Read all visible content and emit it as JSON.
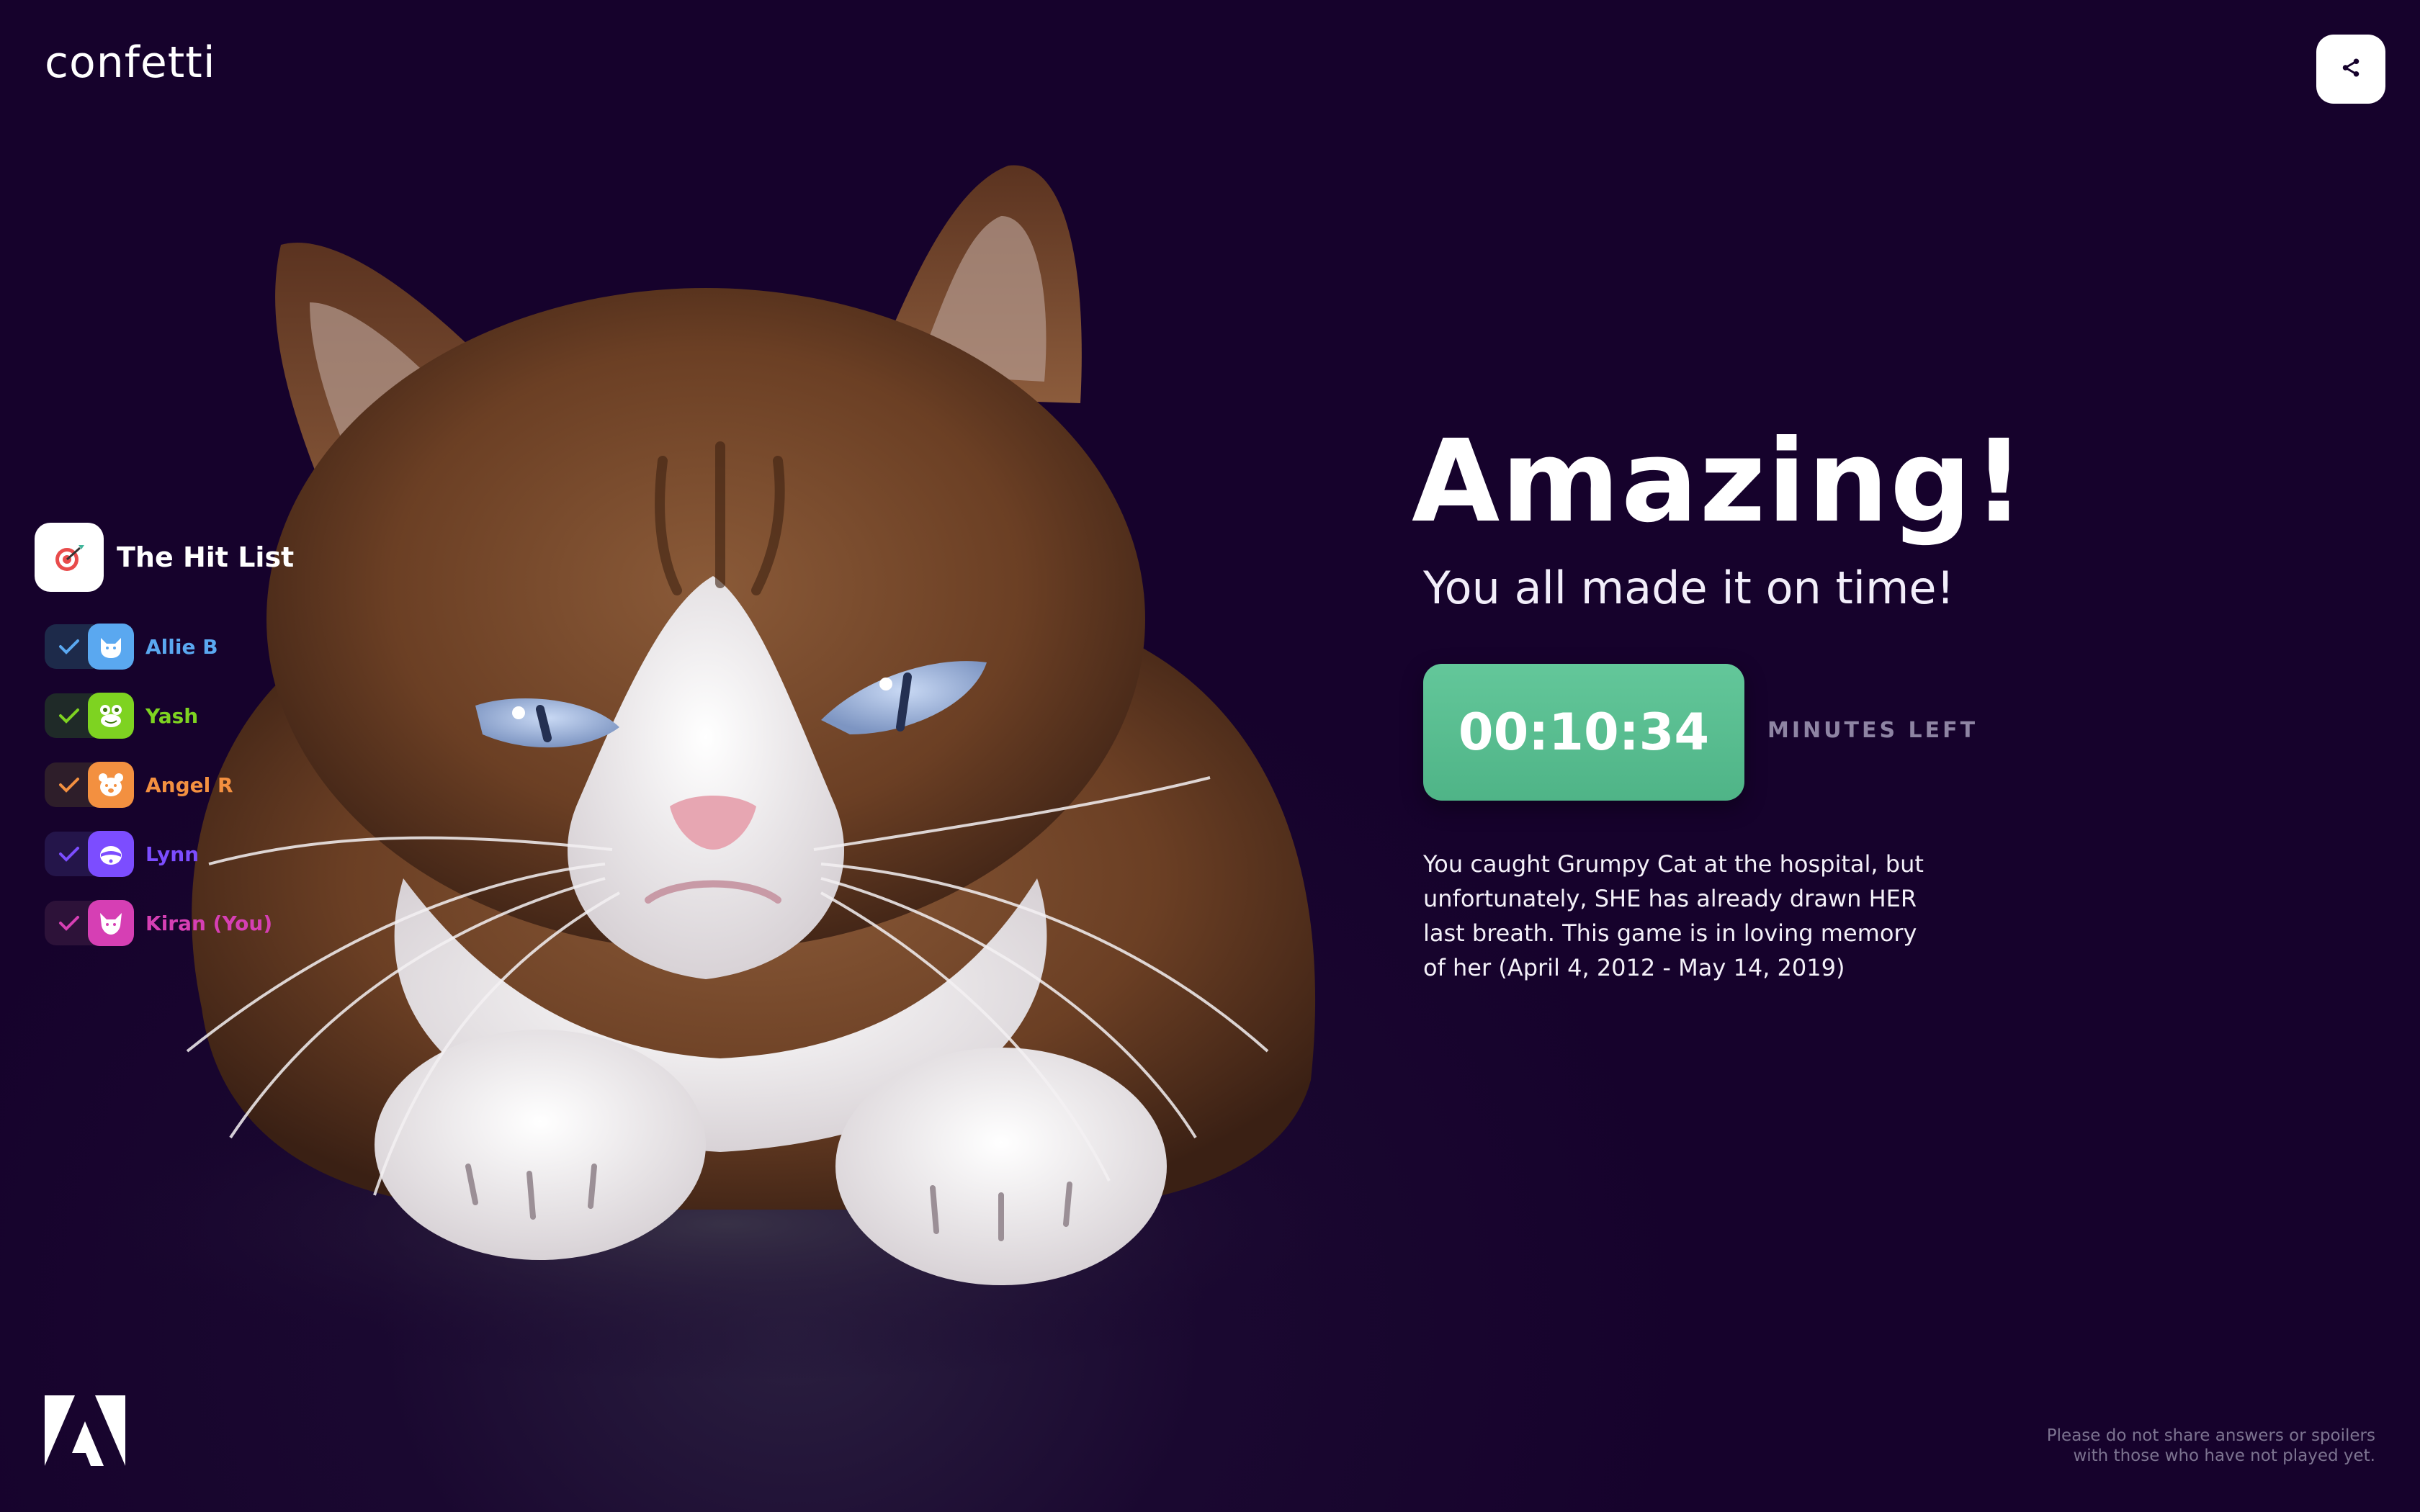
{
  "brand": {
    "logo_text": "confetti"
  },
  "header": {
    "share_icon": "share-icon"
  },
  "hitlist": {
    "title": "The Hit List",
    "icon": "target-icon",
    "players": [
      {
        "name": "Allie B",
        "avatar": "cat-avatar-icon",
        "color": "#5aa8f0",
        "bg": "#1d2a4a"
      },
      {
        "name": "Yash",
        "avatar": "frog-avatar-icon",
        "color": "#7ed321",
        "bg": "#1f2a28"
      },
      {
        "name": "Angel R",
        "avatar": "bear-avatar-icon",
        "color": "#f39040",
        "bg": "#2e1e2a"
      },
      {
        "name": "Lynn",
        "avatar": "raccoon-avatar-icon",
        "color": "#7c4dff",
        "bg": "#24154a"
      },
      {
        "name": "Kiran (You)",
        "avatar": "fox-avatar-icon",
        "color": "#d63fb4",
        "bg": "#2d1239"
      }
    ]
  },
  "result": {
    "headline": "Amazing!",
    "subhead": "You all made it on time!",
    "timer": "00:10:34",
    "timer_label": "MINUTES LEFT",
    "description": "You caught Grumpy Cat at the hospital, but unfortunately, SHE has already drawn HER last breath. This game is in loving memory of her (April 4, 2012 - May 14, 2019)"
  },
  "footer": {
    "adobe_icon": "adobe-logo-icon",
    "disclaimer_line1": "Please do not share answers or spoilers",
    "disclaimer_line2": "with those who have not played yet."
  },
  "colors": {
    "background": "#16022c",
    "timer": "#5bbf91",
    "accent_text": "#8e84a3"
  }
}
